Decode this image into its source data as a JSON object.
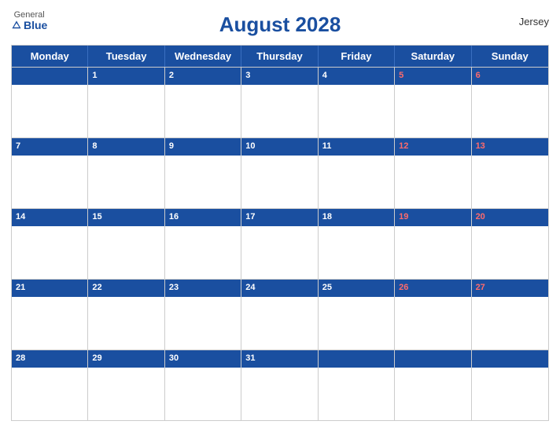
{
  "header": {
    "logo_general": "General",
    "logo_blue": "Blue",
    "title": "August 2028",
    "region": "Jersey"
  },
  "calendar": {
    "month": "August 2028",
    "days_of_week": [
      "Monday",
      "Tuesday",
      "Wednesday",
      "Thursday",
      "Friday",
      "Saturday",
      "Sunday"
    ],
    "weeks": [
      [
        {
          "day": "",
          "weekend": false
        },
        {
          "day": "1",
          "weekend": false
        },
        {
          "day": "2",
          "weekend": false
        },
        {
          "day": "3",
          "weekend": false
        },
        {
          "day": "4",
          "weekend": false
        },
        {
          "day": "5",
          "weekend": true
        },
        {
          "day": "6",
          "weekend": true
        }
      ],
      [
        {
          "day": "7",
          "weekend": false
        },
        {
          "day": "8",
          "weekend": false
        },
        {
          "day": "9",
          "weekend": false
        },
        {
          "day": "10",
          "weekend": false
        },
        {
          "day": "11",
          "weekend": false
        },
        {
          "day": "12",
          "weekend": true
        },
        {
          "day": "13",
          "weekend": true
        }
      ],
      [
        {
          "day": "14",
          "weekend": false
        },
        {
          "day": "15",
          "weekend": false
        },
        {
          "day": "16",
          "weekend": false
        },
        {
          "day": "17",
          "weekend": false
        },
        {
          "day": "18",
          "weekend": false
        },
        {
          "day": "19",
          "weekend": true
        },
        {
          "day": "20",
          "weekend": true
        }
      ],
      [
        {
          "day": "21",
          "weekend": false
        },
        {
          "day": "22",
          "weekend": false
        },
        {
          "day": "23",
          "weekend": false
        },
        {
          "day": "24",
          "weekend": false
        },
        {
          "day": "25",
          "weekend": false
        },
        {
          "day": "26",
          "weekend": true
        },
        {
          "day": "27",
          "weekend": true
        }
      ],
      [
        {
          "day": "28",
          "weekend": false
        },
        {
          "day": "29",
          "weekend": false
        },
        {
          "day": "30",
          "weekend": false
        },
        {
          "day": "31",
          "weekend": false
        },
        {
          "day": "",
          "weekend": false
        },
        {
          "day": "",
          "weekend": false
        },
        {
          "day": "",
          "weekend": false
        }
      ]
    ]
  }
}
